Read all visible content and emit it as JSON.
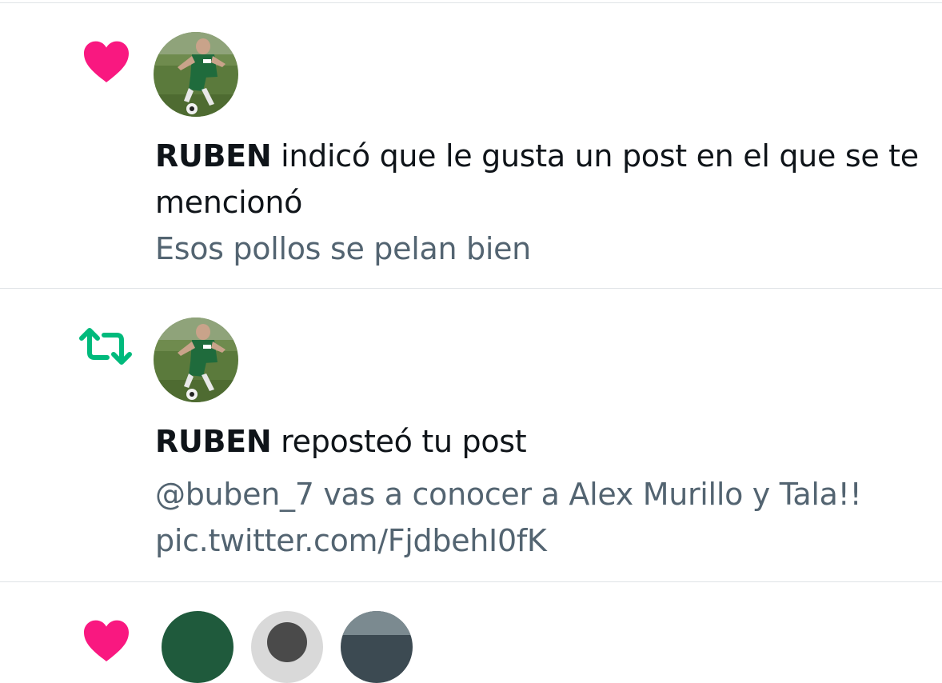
{
  "notifications": [
    {
      "type": "like",
      "icon": "heart-icon",
      "icon_color": "#f91880",
      "user_name": "RUBEN",
      "action": " indicó que le gusta un post en el que se te mencionó",
      "snippet": "Esos pollos se pelan bien"
    },
    {
      "type": "repost",
      "icon": "repost-icon",
      "icon_color": "#00ba7c",
      "user_name": "RUBEN",
      "action": " reposteó tu post",
      "snippet_line1": "@buben_7 vas a conocer a Alex Murillo y Tala!!",
      "snippet_line2": "pic.twitter.com/FjdbehI0fK"
    },
    {
      "type": "like",
      "icon": "heart-icon",
      "icon_color": "#f91880"
    }
  ],
  "colors": {
    "text_primary": "#0f1419",
    "text_secondary": "#536471",
    "divider": "#dfe3e6"
  }
}
